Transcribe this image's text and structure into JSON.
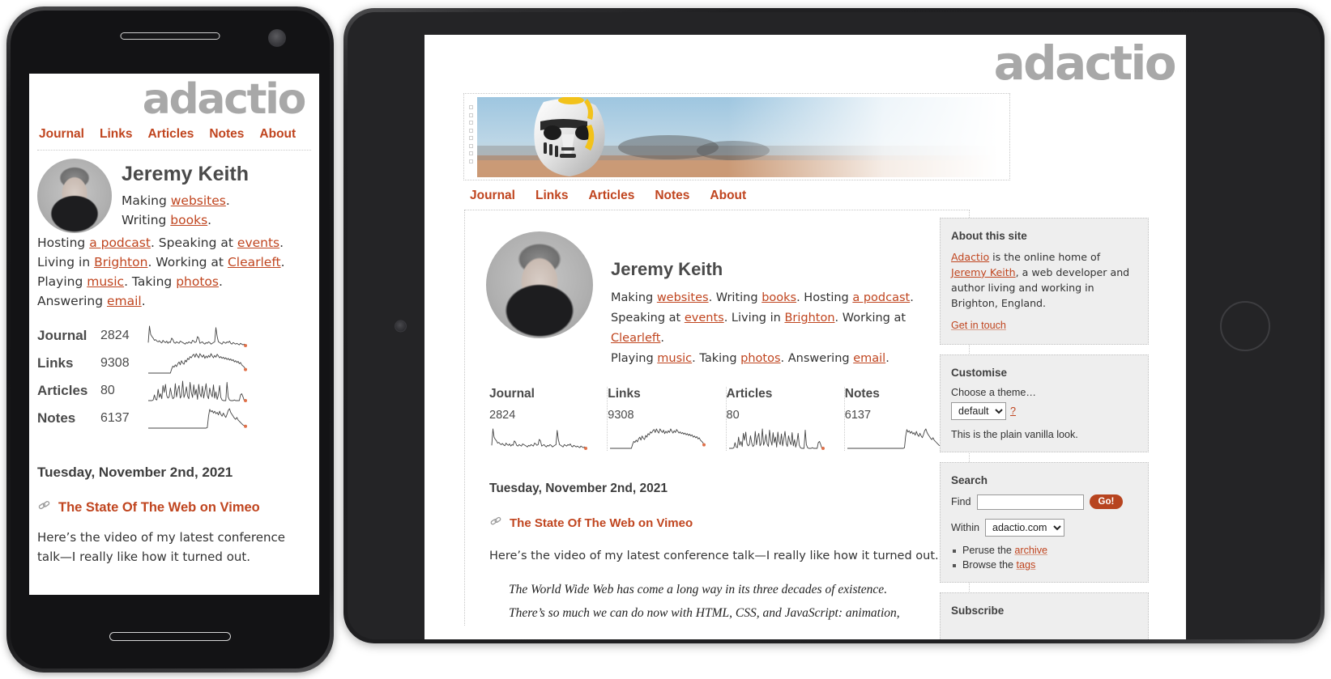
{
  "site": {
    "logo": "adactio",
    "nav": [
      {
        "label": "Journal"
      },
      {
        "label": "Links"
      },
      {
        "label": "Articles"
      },
      {
        "label": "Notes"
      },
      {
        "label": "About"
      }
    ],
    "profile": {
      "name": "Jeremy Keith",
      "bio_parts": [
        "Making ",
        "websites",
        ". Writing ",
        "books",
        ". Hosting ",
        "a podcast",
        ".",
        "Speaking at ",
        "events",
        ". Living in ",
        "Brighton",
        ". Working at ",
        "Clearleft",
        ".",
        "Playing ",
        "music",
        ". Taking ",
        "photos",
        ". Answering ",
        "email",
        "."
      ],
      "line1_pre": "Making ",
      "link_websites": "websites",
      "line1_mid": ". Writing ",
      "link_books": "books",
      "line1_post": ". Hosting ",
      "link_podcast": "a podcast",
      "line1_end": ".",
      "line2_pre": "Speaking at ",
      "link_events": "events",
      "line2_mid": ". Living in ",
      "link_brighton": "Brighton",
      "line2_post": ". Working at ",
      "link_clearleft": "Clearleft",
      "line2_end": ".",
      "line3_pre": "Playing ",
      "link_music": "music",
      "line3_mid": ". Taking ",
      "link_photos": "photos",
      "line3_post": ". Answering ",
      "link_email": "email",
      "line3_end": "."
    },
    "entry": {
      "date": "Tuesday, November 2nd, 2021",
      "title": "The State Of The Web on Vimeo",
      "link_icon": "link-icon",
      "body": "Here’s the video of my latest conference talk—I really like how it turned out.",
      "blockquote_line1": "The World Wide Web has come a long way in its three decades of existence.",
      "blockquote_line2": "There’s so much we can do now with HTML, CSS, and JavaScript: animation,"
    },
    "banner_alt": "stormtrooper-banner-image"
  },
  "chart_data": {
    "type": "line",
    "title": "Site activity sparklines",
    "grid": false,
    "legend": "none",
    "series": [
      {
        "name": "Journal",
        "count": 2824,
        "values": [
          18,
          62,
          40,
          34,
          30,
          24,
          26,
          22,
          20,
          23,
          19,
          17,
          24,
          20,
          18,
          22,
          16,
          20,
          18,
          30,
          26,
          18,
          16,
          20,
          18,
          16,
          22,
          20,
          18,
          16,
          14,
          18,
          16,
          20,
          18,
          16,
          24,
          22,
          18,
          20,
          34,
          30,
          16,
          18,
          20,
          16,
          14,
          18,
          16,
          20,
          18,
          14,
          16,
          18,
          20,
          58,
          34,
          20,
          18,
          16,
          14,
          20,
          18,
          16,
          20,
          18,
          22,
          16,
          14,
          18,
          16,
          14,
          16,
          14,
          12,
          16,
          14,
          12,
          14,
          10
        ]
      },
      {
        "name": "Links",
        "count": 9308,
        "values": [
          6,
          6,
          6,
          6,
          6,
          6,
          6,
          6,
          6,
          6,
          6,
          6,
          6,
          6,
          6,
          6,
          6,
          6,
          6,
          20,
          30,
          26,
          34,
          28,
          38,
          44,
          34,
          48,
          40,
          36,
          50,
          44,
          56,
          52,
          62,
          58,
          66,
          70,
          60,
          72,
          64,
          58,
          72,
          66,
          60,
          68,
          56,
          64,
          58,
          66,
          60,
          72,
          64,
          58,
          66,
          60,
          70,
          64,
          58,
          62,
          56,
          60,
          54,
          58,
          52,
          56,
          50,
          54,
          48,
          52,
          44,
          48,
          42,
          46,
          38,
          42,
          34,
          30,
          26,
          18
        ]
      },
      {
        "name": "Articles",
        "count": 80,
        "values": [
          8,
          8,
          8,
          8,
          10,
          26,
          12,
          10,
          44,
          18,
          30,
          14,
          56,
          34,
          60,
          24,
          16,
          20,
          48,
          26,
          14,
          18,
          62,
          20,
          42,
          56,
          16,
          24,
          70,
          18,
          30,
          52,
          22,
          14,
          66,
          34,
          18,
          58,
          26,
          44,
          12,
          60,
          30,
          20,
          54,
          16,
          38,
          62,
          24,
          14,
          48,
          30,
          20,
          58,
          16,
          36,
          12,
          26,
          56,
          18,
          10,
          8,
          8,
          8,
          66,
          20,
          10,
          8,
          8,
          8,
          10,
          8,
          8,
          8,
          8,
          26,
          30,
          20,
          8,
          8
        ]
      },
      {
        "name": "Notes",
        "count": 6137,
        "values": [
          2,
          2,
          2,
          2,
          2,
          2,
          2,
          2,
          2,
          2,
          2,
          2,
          2,
          2,
          2,
          2,
          2,
          2,
          2,
          2,
          2,
          2,
          2,
          2,
          2,
          2,
          2,
          2,
          2,
          2,
          2,
          2,
          2,
          2,
          2,
          2,
          2,
          2,
          2,
          2,
          2,
          2,
          2,
          2,
          2,
          2,
          2,
          2,
          4,
          40,
          62,
          54,
          58,
          50,
          56,
          48,
          52,
          44,
          56,
          46,
          40,
          50,
          42,
          36,
          46,
          58,
          64,
          52,
          46,
          40,
          34,
          30,
          36,
          28,
          24,
          20,
          16,
          12,
          10,
          8
        ]
      }
    ],
    "marker_color": "#e0714a",
    "line_color": "#444444"
  },
  "sidebar": {
    "about": {
      "heading": "About this site",
      "text_pre": "",
      "link_adactio": "Adactio",
      "text_mid": " is the online home of ",
      "link_jeremy": "Jeremy Keith",
      "text_post": ", a web developer and author living and working in Brighton, England.",
      "get_in_touch": "Get in touch"
    },
    "customise": {
      "heading": "Customise",
      "choose_label": "Choose a theme…",
      "selected_theme": "default",
      "theme_options": [
        "default"
      ],
      "help": "?",
      "description": "This is the plain vanilla look."
    },
    "search": {
      "heading": "Search",
      "find_label": "Find",
      "find_value": "",
      "find_placeholder": "",
      "go_label": "Go!",
      "within_label": "Within",
      "within_selected": "adactio.com",
      "within_options": [
        "adactio.com"
      ],
      "links": [
        {
          "pre": "Peruse the ",
          "link": "archive"
        },
        {
          "pre": "Browse the ",
          "link": "tags"
        }
      ]
    },
    "subscribe": {
      "heading": "Subscribe"
    }
  },
  "colors": {
    "accent": "#c0451f",
    "logo_grey": "#a8a8a8",
    "text": "#333333",
    "panel_bg": "#eeeeee",
    "go_button": "#b7441f",
    "spark_marker": "#e0714a"
  }
}
